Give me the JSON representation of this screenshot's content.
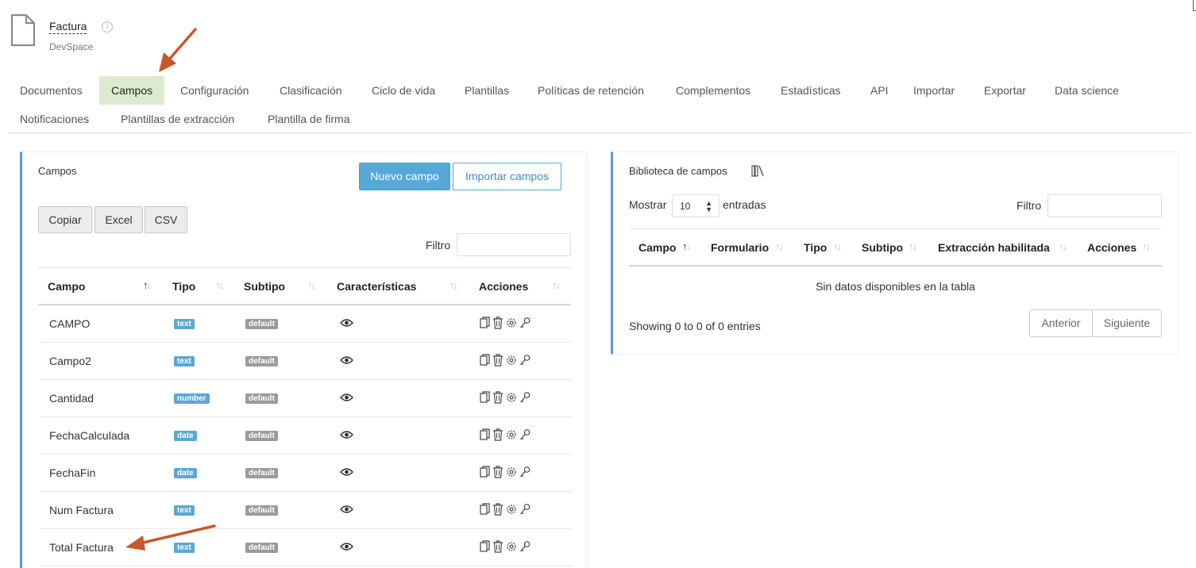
{
  "header": {
    "title": "Factura",
    "info_icon": "info-icon",
    "subtitle": "DevSpace"
  },
  "tabs": [
    {
      "label": "Documentos",
      "active": false
    },
    {
      "label": "Campos",
      "active": true
    },
    {
      "label": "Configuración",
      "active": false
    },
    {
      "label": "Clasificación",
      "active": false
    },
    {
      "label": "Ciclo de vida",
      "active": false
    },
    {
      "label": "Plantillas",
      "active": false
    },
    {
      "label": "Políticas de retención",
      "active": false
    },
    {
      "label": "Complementos",
      "active": false
    },
    {
      "label": "Estadísticas",
      "active": false
    },
    {
      "label": "API",
      "active": false
    },
    {
      "label": "Importar",
      "active": false
    },
    {
      "label": "Exportar",
      "active": false
    },
    {
      "label": "Data science",
      "active": false
    },
    {
      "label": "Notificaciones",
      "active": false
    },
    {
      "label": "Plantillas de extracción",
      "active": false
    },
    {
      "label": "Plantilla de firma",
      "active": false
    }
  ],
  "campos": {
    "title": "Campos",
    "new_button": "Nuevo campo",
    "import_button": "Importar campos",
    "export_buttons": [
      "Copiar",
      "Excel",
      "CSV"
    ],
    "filter_label": "Filtro",
    "filter_value": "",
    "columns": [
      "Campo",
      "Tipo",
      "Subtipo",
      "Características",
      "Acciones"
    ],
    "rows": [
      {
        "campo": "CAMPO",
        "tipo": "text",
        "subtipo": "default"
      },
      {
        "campo": "Campo2",
        "tipo": "text",
        "subtipo": "default"
      },
      {
        "campo": "Cantidad",
        "tipo": "number",
        "subtipo": "default"
      },
      {
        "campo": "FechaCalculada",
        "tipo": "date",
        "subtipo": "default"
      },
      {
        "campo": "FechaFin",
        "tipo": "date",
        "subtipo": "default"
      },
      {
        "campo": "Num Factura",
        "tipo": "text",
        "subtipo": "default"
      },
      {
        "campo": "Total Factura",
        "tipo": "text",
        "subtipo": "default"
      }
    ],
    "row_icons": [
      "eye-icon",
      "copy-icon",
      "trash-icon",
      "gear-icon",
      "key-icon"
    ]
  },
  "biblioteca": {
    "title": "Biblioteca de campos",
    "title_icon": "books-icon",
    "show_label": "Mostrar",
    "entries_value": "10",
    "entries_label": "entradas",
    "filter_label": "Filtro",
    "filter_value": "",
    "columns": [
      "Campo",
      "Formulario",
      "Tipo",
      "Subtipo",
      "Extracción habilitada",
      "Acciones"
    ],
    "empty_message": "Sin datos disponibles en la tabla",
    "info": "Showing 0 to 0 of 0 entries",
    "prev_button": "Anterior",
    "next_button": "Siguiente"
  },
  "colors": {
    "accent": "#55a8d8",
    "active_tab": "#dcebd0",
    "panel_border": "#5b9bd5",
    "annotation_arrow": "#c8572a"
  }
}
